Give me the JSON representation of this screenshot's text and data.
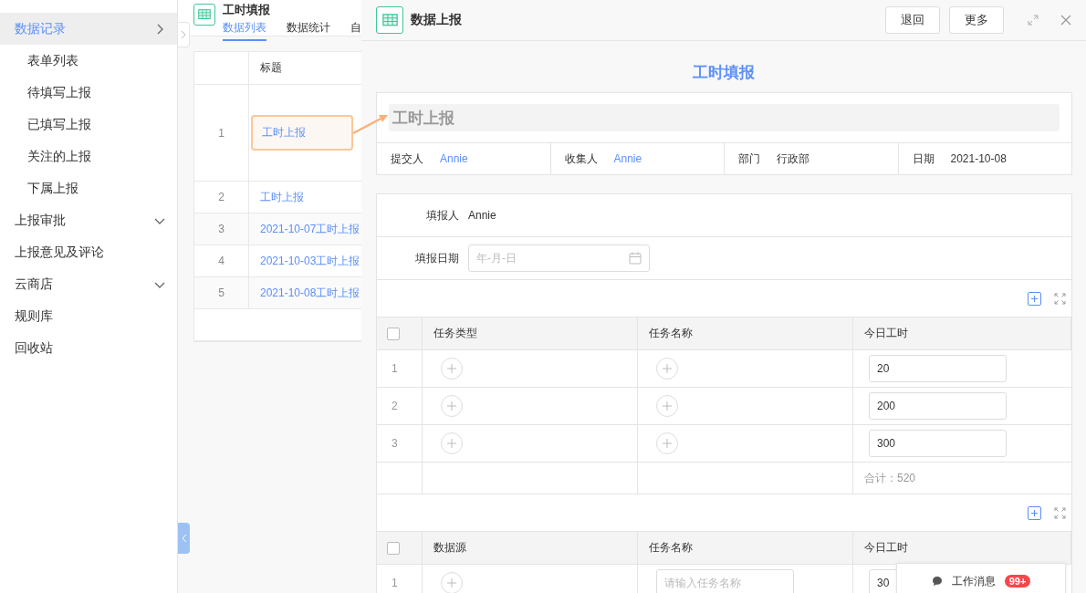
{
  "sidebar": {
    "items": [
      {
        "label": "数据记录",
        "selected": true,
        "expanded": true,
        "children": [
          {
            "label": "表单列表",
            "selected": false
          },
          {
            "label": "待填写上报",
            "selected": false
          },
          {
            "label": "已填写上报",
            "selected": false
          },
          {
            "label": "关注的上报",
            "selected": false
          },
          {
            "label": "下属上报",
            "selected": false
          }
        ]
      },
      {
        "label": "上报审批",
        "selected": false,
        "expanded": false
      },
      {
        "label": "上报意见及评论",
        "selected": false
      },
      {
        "label": "云商店",
        "selected": false,
        "expanded": false
      },
      {
        "label": "规则库",
        "selected": false
      },
      {
        "label": "回收站",
        "selected": false
      }
    ]
  },
  "list_panel": {
    "title": "工时填报",
    "tabs": [
      {
        "label": "数据列表",
        "selected": true
      },
      {
        "label": "数据统计",
        "selected": false
      },
      {
        "label": "自",
        "selected": false
      }
    ],
    "table": {
      "columns": [
        "标题"
      ],
      "rows": [
        {
          "index": "1",
          "title": "工时上报",
          "selected": true
        },
        {
          "index": "2",
          "title": "工时上报",
          "selected": false
        },
        {
          "index": "3",
          "title": "2021-10-07工时上报",
          "selected": false
        },
        {
          "index": "4",
          "title": "2021-10-03工时上报",
          "selected": false
        },
        {
          "index": "5",
          "title": "2021-10-08工时上报",
          "selected": false
        }
      ]
    }
  },
  "drawer": {
    "title": "数据上报",
    "buttons": [
      "退回",
      "更多"
    ],
    "form_title": "工时填报",
    "report_title": "工时上报",
    "info": [
      {
        "label": "提交人",
        "value": "Annie",
        "link": true
      },
      {
        "label": "收集人",
        "value": "Annie",
        "link": true
      },
      {
        "label": "部门",
        "value": "行政部",
        "link": false
      },
      {
        "label": "日期",
        "value": "2021-10-08",
        "link": false
      }
    ],
    "fields": [
      {
        "kind": "text",
        "label": "填报人",
        "value": "Annie"
      },
      {
        "kind": "date",
        "label": "填报日期",
        "placeholder": "年-月-日"
      }
    ],
    "subtables": [
      {
        "checked": false,
        "columns": [
          "任务类型",
          "任务名称",
          "今日工时"
        ],
        "rows": [
          {
            "index": "1",
            "hours": "20"
          },
          {
            "index": "2",
            "hours": "200"
          },
          {
            "index": "3",
            "hours": "300"
          }
        ],
        "total": "合计：520"
      },
      {
        "checked": false,
        "columns": [
          "数据源",
          "任务名称",
          "今日工时"
        ],
        "rows": [
          {
            "index": "1",
            "name_placeholder": "请输入任务名称",
            "hours": "30"
          }
        ]
      }
    ]
  },
  "messages": {
    "label": "工作消息",
    "badge": "99+"
  }
}
